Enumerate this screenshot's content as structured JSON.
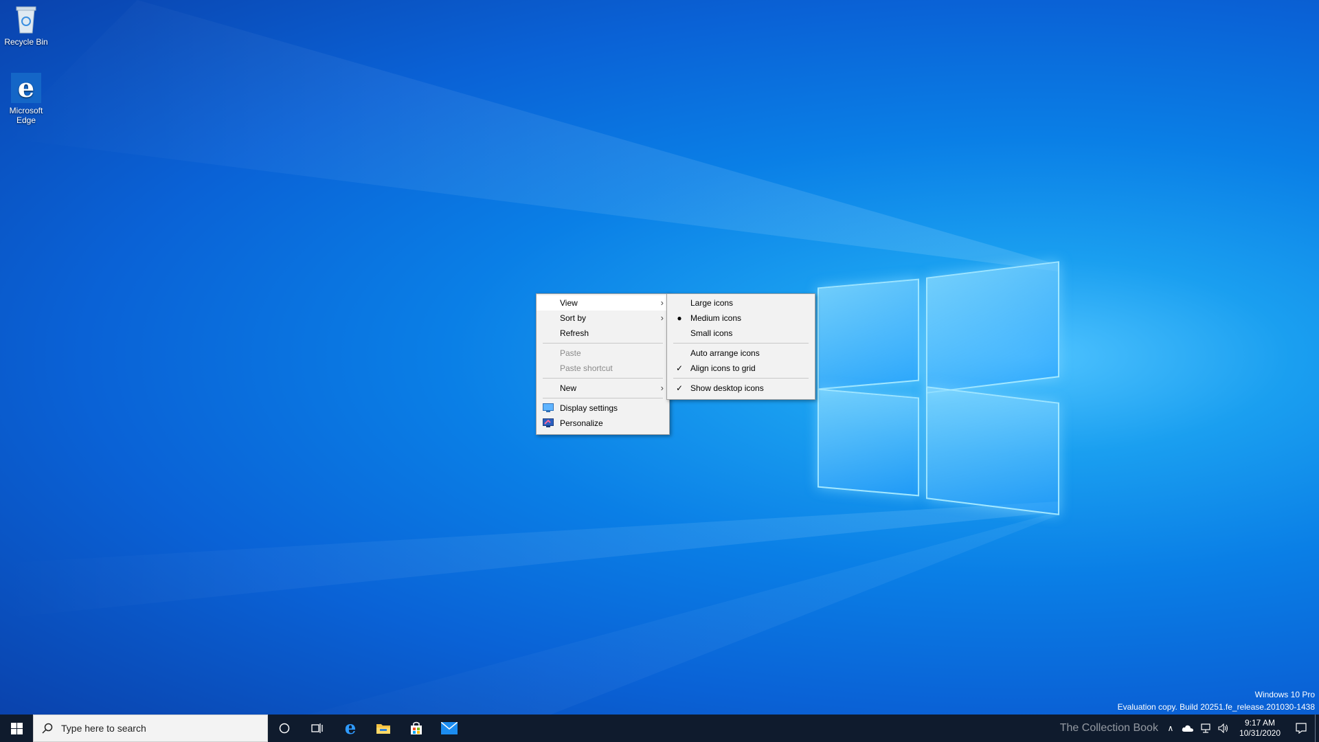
{
  "desktop": {
    "icons": [
      {
        "label": "Recycle Bin"
      },
      {
        "label": "Microsoft Edge"
      }
    ]
  },
  "context_menu": {
    "items": [
      {
        "label": "View",
        "submenu": true,
        "hover": true
      },
      {
        "label": "Sort by",
        "submenu": true
      },
      {
        "label": "Refresh"
      },
      {
        "label": "Paste",
        "disabled": true
      },
      {
        "label": "Paste shortcut",
        "disabled": true
      },
      {
        "label": "New",
        "submenu": true
      },
      {
        "label": "Display settings",
        "icon": "display-icon"
      },
      {
        "label": "Personalize",
        "icon": "personalize-icon"
      }
    ]
  },
  "view_submenu": {
    "items": [
      {
        "label": "Large icons"
      },
      {
        "label": "Medium icons",
        "selected": true
      },
      {
        "label": "Small icons"
      },
      {
        "label": "Auto arrange icons"
      },
      {
        "label": "Align icons to grid",
        "checked": true
      },
      {
        "label": "Show desktop icons",
        "checked": true
      }
    ]
  },
  "taskbar": {
    "search_placeholder": "Type here to search",
    "pinned": [
      "cortana-icon",
      "task-view-icon",
      "edge-icon",
      "file-explorer-icon",
      "store-icon",
      "mail-icon"
    ],
    "clock_time": "9:17 AM",
    "clock_date": "10/31/2020"
  },
  "watermark": {
    "edition": "Windows 10 Pro",
    "build": "Evaluation copy. Build 20251.fe_release.201030-1438",
    "overlay": "The Collection Book"
  },
  "colors": {
    "menu_bg": "#f2f2f2",
    "taskbar_bg": "#0f1b2d",
    "desktop_accent": "#0a7fe6"
  }
}
